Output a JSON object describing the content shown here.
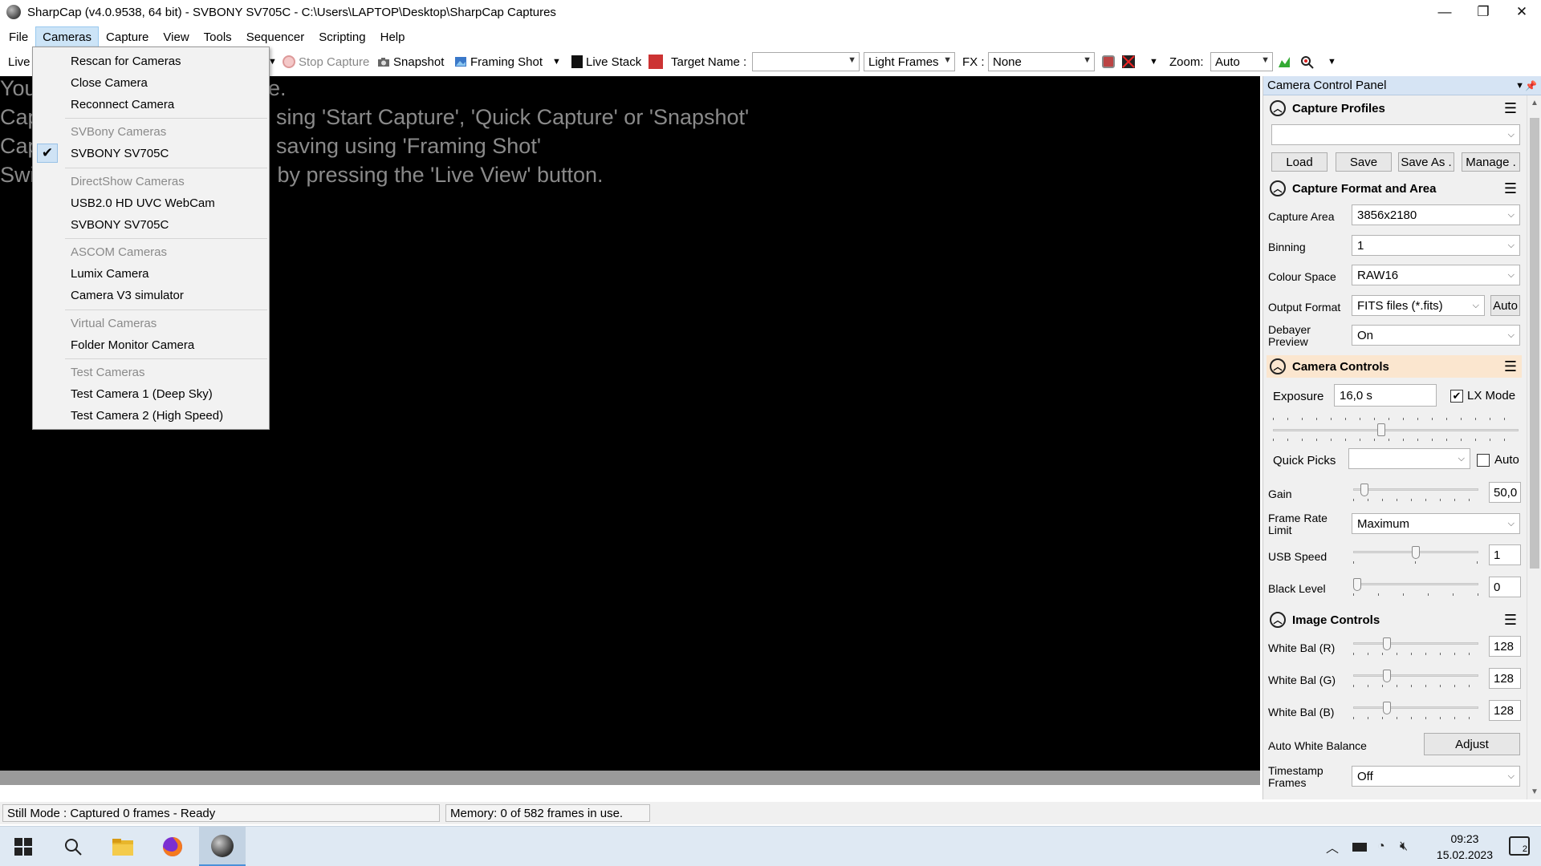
{
  "window": {
    "title": "SharpCap (v4.0.9538, 64 bit) - SVBONY SV705C - C:\\Users\\LAPTOP\\Desktop\\SharpCap Captures",
    "minimize": "—",
    "restore": "❐",
    "close": "✕"
  },
  "menubar": [
    "File",
    "Cameras",
    "Capture",
    "View",
    "Tools",
    "Sequencer",
    "Scripting",
    "Help"
  ],
  "toolbar": {
    "live": "Live",
    "stop_capture": "Stop Capture",
    "snapshot": "Snapshot",
    "framing_shot": "Framing Shot",
    "live_stack": "Live Stack",
    "target_name_label": "Target Name :",
    "target_name_value": "",
    "frame_type": "Light Frames",
    "fx_label": "FX :",
    "fx_value": "None",
    "zoom_label": "Zoom:",
    "zoom_value": "Auto"
  },
  "viewport": {
    "lines": [
      "You",
      "Cap",
      "Cap",
      "Swi"
    ],
    "lines_right": [
      "e.",
      "sing 'Start Capture', 'Quick Capture' or 'Snapshot'",
      "saving using 'Framing Shot'",
      " by pressing the 'Live View' button."
    ]
  },
  "cameras_menu": {
    "items": [
      {
        "label": "Rescan for Cameras",
        "type": "item"
      },
      {
        "label": "Close Camera",
        "type": "item"
      },
      {
        "label": "Reconnect Camera",
        "type": "item"
      },
      {
        "label": "SVBony Cameras",
        "type": "header"
      },
      {
        "label": "SVBONY SV705C",
        "type": "item",
        "checked": true
      },
      {
        "label": "DirectShow Cameras",
        "type": "header"
      },
      {
        "label": "USB2.0 HD UVC WebCam",
        "type": "item"
      },
      {
        "label": "SVBONY SV705C",
        "type": "item"
      },
      {
        "label": "ASCOM Cameras",
        "type": "header"
      },
      {
        "label": "Lumix Camera",
        "type": "item"
      },
      {
        "label": "Camera V3 simulator",
        "type": "item"
      },
      {
        "label": "Virtual Cameras",
        "type": "header"
      },
      {
        "label": "Folder Monitor Camera",
        "type": "item"
      },
      {
        "label": "Test Cameras",
        "type": "header"
      },
      {
        "label": "Test Camera 1 (Deep Sky)",
        "type": "item"
      },
      {
        "label": "Test Camera 2 (High Speed)",
        "type": "item"
      }
    ]
  },
  "panel": {
    "title": "Camera Control Panel",
    "capture_profiles": {
      "heading": "Capture Profiles",
      "profile_value": "",
      "load": "Load",
      "save": "Save",
      "save_as": "Save As .",
      "manage": "Manage ."
    },
    "capture_format": {
      "heading": "Capture Format and Area",
      "capture_area_label": "Capture Area",
      "capture_area": "3856x2180",
      "binning_label": "Binning",
      "binning": "1",
      "colour_space_label": "Colour Space",
      "colour_space": "RAW16",
      "output_format_label": "Output Format",
      "output_format": "FITS files (*.fits)",
      "auto": "Auto",
      "debayer_label_1": "Debayer",
      "debayer_label_2": "Preview",
      "debayer": "On"
    },
    "camera_controls": {
      "heading": "Camera Controls",
      "exposure_label": "Exposure",
      "exposure": "16,0 s",
      "lx_mode": "LX Mode",
      "lx_checked": true,
      "exposure_slider": 0.44,
      "quick_picks_label": "Quick Picks",
      "quick_picks": "",
      "quick_auto": "Auto",
      "gain_label": "Gain",
      "gain": "50,0",
      "gain_slider": 0.06,
      "frame_rate_label_1": "Frame Rate",
      "frame_rate_label_2": "Limit",
      "frame_rate": "Maximum",
      "usb_label": "USB Speed",
      "usb": "1",
      "usb_slider": 0.5,
      "black_label": "Black Level",
      "black": "0",
      "black_slider": 0.0
    },
    "image_controls": {
      "heading": "Image Controls",
      "wb_r_label": "White Bal (R)",
      "wb_r": "128",
      "wb_g_label": "White Bal (G)",
      "wb_g": "128",
      "wb_b_label": "White Bal (B)",
      "wb_b": "128",
      "wb_slider": 0.25,
      "awb_label": "Auto White Balance",
      "adjust": "Adjust",
      "timestamp_label_1": "Timestamp",
      "timestamp_label_2": "Frames",
      "timestamp": "Off"
    }
  },
  "statusbar": {
    "mode": "Still Mode : Captured 0 frames - Ready",
    "memory": "Memory: 0 of 582 frames in use."
  },
  "taskbar": {
    "time": "09:23",
    "date": "15.02.2023",
    "notifications": "2"
  },
  "colors": {
    "menu_active": "#cce4f7",
    "panel_title": "#d6e4f4",
    "section_highlight": "#fbe6cf"
  }
}
